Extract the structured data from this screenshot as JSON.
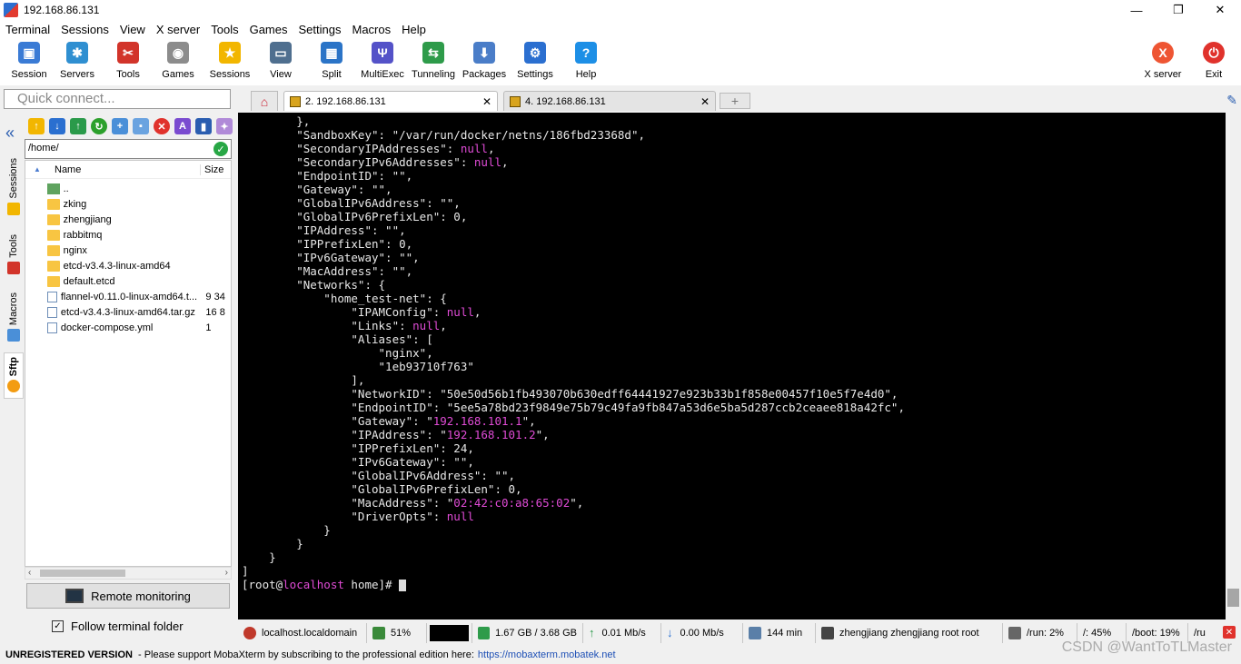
{
  "window": {
    "title": "192.168.86.131",
    "controls": [
      "—",
      "❐",
      "✕"
    ]
  },
  "menu": [
    "Terminal",
    "Sessions",
    "View",
    "X server",
    "Tools",
    "Games",
    "Settings",
    "Macros",
    "Help"
  ],
  "toolbar": [
    {
      "label": "Session",
      "icon": "session-icon",
      "color": "#3a7bd5",
      "glyph": "▣"
    },
    {
      "label": "Servers",
      "icon": "servers-icon",
      "color": "#2f8fd1",
      "glyph": "✱"
    },
    {
      "label": "Tools",
      "icon": "tools-icon",
      "color": "#d2342a",
      "glyph": "✂"
    },
    {
      "label": "Games",
      "icon": "games-icon",
      "color": "#8c8c8c",
      "glyph": "◉"
    },
    {
      "label": "Sessions",
      "icon": "star-icon",
      "color": "#f2b600",
      "glyph": "★"
    },
    {
      "label": "View",
      "icon": "view-icon",
      "color": "#4f6f8f",
      "glyph": "▭"
    },
    {
      "label": "Split",
      "icon": "split-icon",
      "color": "#2b74c7",
      "glyph": "▦"
    },
    {
      "label": "MultiExec",
      "icon": "multiexec-icon",
      "color": "#5452c8",
      "glyph": "Ψ"
    },
    {
      "label": "Tunneling",
      "icon": "tunneling-icon",
      "color": "#2e9b4a",
      "glyph": "⇆"
    },
    {
      "label": "Packages",
      "icon": "packages-icon",
      "color": "#4a7dc8",
      "glyph": "⬇"
    },
    {
      "label": "Settings",
      "icon": "settings-icon",
      "color": "#2b6fd0",
      "glyph": "⚙"
    },
    {
      "label": "Help",
      "icon": "help-icon",
      "color": "#1d8fe6",
      "glyph": "?"
    }
  ],
  "toolbar_right": [
    {
      "label": "X server",
      "icon": "xserver-icon",
      "color": "#e53",
      "glyph": "X"
    },
    {
      "label": "Exit",
      "icon": "power-icon",
      "color": "#e0322c",
      "glyph": "⏻"
    }
  ],
  "quick_connect": {
    "placeholder": "Quick connect..."
  },
  "tabs": [
    {
      "label": "2. 192.168.86.131",
      "close": "✕"
    },
    {
      "label": "4. 192.168.86.131",
      "close": "✕"
    }
  ],
  "side_tabs": [
    "Sessions",
    "Tools",
    "Macros",
    "Sftp"
  ],
  "sftp": {
    "path": "/home/",
    "columns": {
      "name": "Name",
      "size": "Size"
    },
    "files": [
      {
        "name": "..",
        "size": "",
        "kind": "up"
      },
      {
        "name": "zking",
        "size": "",
        "kind": "folder"
      },
      {
        "name": "zhengjiang",
        "size": "",
        "kind": "folder"
      },
      {
        "name": "rabbitmq",
        "size": "",
        "kind": "folder"
      },
      {
        "name": "nginx",
        "size": "",
        "kind": "folder"
      },
      {
        "name": "etcd-v3.4.3-linux-amd64",
        "size": "",
        "kind": "folder"
      },
      {
        "name": "default.etcd",
        "size": "",
        "kind": "folder"
      },
      {
        "name": "flannel-v0.11.0-linux-amd64.t...",
        "size": "9 34",
        "kind": "file"
      },
      {
        "name": "etcd-v3.4.3-linux-amd64.tar.gz",
        "size": "16 8",
        "kind": "file"
      },
      {
        "name": "docker-compose.yml",
        "size": "1",
        "kind": "file"
      }
    ],
    "remote_monitoring": "Remote monitoring",
    "follow_terminal": "Follow terminal folder",
    "follow_checked": "✓"
  },
  "terminal": {
    "lines": [
      [
        {
          "t": "        },"
        }
      ],
      [
        {
          "t": "        \"SandboxKey\": \"/var/run/docker/netns/186fbd23368d\","
        }
      ],
      [
        {
          "t": "        \"SecondaryIPAddresses\": "
        },
        {
          "t": "null",
          "m": true
        },
        {
          "t": ","
        }
      ],
      [
        {
          "t": "        \"SecondaryIPv6Addresses\": "
        },
        {
          "t": "null",
          "m": true
        },
        {
          "t": ","
        }
      ],
      [
        {
          "t": "        \"EndpointID\": \"\","
        }
      ],
      [
        {
          "t": "        \"Gateway\": \"\","
        }
      ],
      [
        {
          "t": "        \"GlobalIPv6Address\": \"\","
        }
      ],
      [
        {
          "t": "        \"GlobalIPv6PrefixLen\": 0,"
        }
      ],
      [
        {
          "t": "        \"IPAddress\": \"\","
        }
      ],
      [
        {
          "t": "        \"IPPrefixLen\": 0,"
        }
      ],
      [
        {
          "t": "        \"IPv6Gateway\": \"\","
        }
      ],
      [
        {
          "t": "        \"MacAddress\": \"\","
        }
      ],
      [
        {
          "t": "        \"Networks\": {"
        }
      ],
      [
        {
          "t": "            \"home_test-net\": {"
        }
      ],
      [
        {
          "t": "                \"IPAMConfig\": "
        },
        {
          "t": "null",
          "m": true
        },
        {
          "t": ","
        }
      ],
      [
        {
          "t": "                \"Links\": "
        },
        {
          "t": "null",
          "m": true
        },
        {
          "t": ","
        }
      ],
      [
        {
          "t": "                \"Aliases\": ["
        }
      ],
      [
        {
          "t": "                    \"nginx\","
        }
      ],
      [
        {
          "t": "                    \"1eb93710f763\""
        }
      ],
      [
        {
          "t": "                ],"
        }
      ],
      [
        {
          "t": "                \"NetworkID\": \"50e50d56b1fb493070b630edff64441927e923b33b1f858e00457f10e5f7e4d0\","
        }
      ],
      [
        {
          "t": "                \"EndpointID\": \"5ee5a78bd23f9849e75b79c49fa9fb847a53d6e5ba5d287ccb2ceaee818a42fc\","
        }
      ],
      [
        {
          "t": "                \"Gateway\": \""
        },
        {
          "t": "192.168.101.1",
          "m": true
        },
        {
          "t": "\","
        }
      ],
      [
        {
          "t": "                \"IPAddress\": \""
        },
        {
          "t": "192.168.101.2",
          "m": true
        },
        {
          "t": "\","
        }
      ],
      [
        {
          "t": "                \"IPPrefixLen\": 24,"
        }
      ],
      [
        {
          "t": "                \"IPv6Gateway\": \"\","
        }
      ],
      [
        {
          "t": "                \"GlobalIPv6Address\": \"\","
        }
      ],
      [
        {
          "t": "                \"GlobalIPv6PrefixLen\": 0,"
        }
      ],
      [
        {
          "t": "                \"MacAddress\": \""
        },
        {
          "t": "02:42:c0:a8:65:02",
          "m": true
        },
        {
          "t": "\","
        }
      ],
      [
        {
          "t": "                \"DriverOpts\": "
        },
        {
          "t": "null",
          "m": true
        }
      ],
      [
        {
          "t": "            }"
        }
      ],
      [
        {
          "t": "        }"
        }
      ],
      [
        {
          "t": "    }"
        }
      ],
      [
        {
          "t": "]"
        }
      ],
      [
        {
          "t": "[root@"
        },
        {
          "t": "localhost",
          "m": true
        },
        {
          "t": " home]# "
        }
      ]
    ]
  },
  "status": {
    "host": "localhost.localdomain",
    "cpu": "51%",
    "memory": "1.67 GB / 3.68 GB",
    "upload": "0.01 Mb/s",
    "download": "0.00 Mb/s",
    "uptime": "144 min",
    "users": "zhengjiang  zhengjiang  root  root",
    "disk_run": "/run: 2%",
    "disk_root": "/: 45%",
    "disk_boot": "/boot: 19%",
    "disk_more": "/ru"
  },
  "notice": {
    "bold": "UNREGISTERED VERSION",
    "text": " -  Please support MobaXterm by subscribing to the professional edition here:",
    "link": "https://mobaxterm.mobatek.net"
  },
  "watermark": "CSDN @WantToTLMaster"
}
